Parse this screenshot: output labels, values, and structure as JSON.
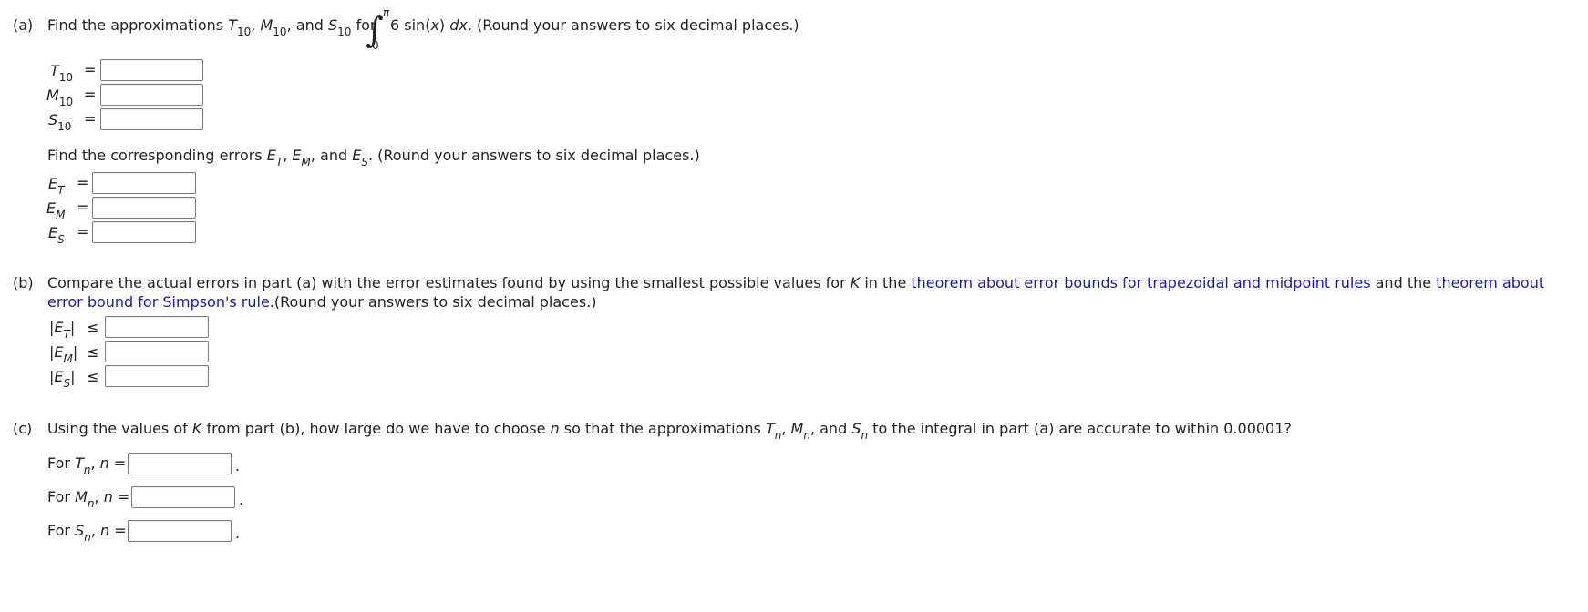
{
  "part_a": {
    "label": "(a)",
    "intro_prefix": "Find the approximations",
    "T": "T",
    "M": "M",
    "S": "S",
    "n10": "10",
    "comma": ",",
    "and": "and",
    "for": "for",
    "integral_sign": "∫",
    "upper_limit": "π",
    "lower_limit": "0",
    "integrand_coef": "6 sin(",
    "integrand_var": "x",
    "integrand_close": ") ",
    "dx_d": "d",
    "dx_x": "x",
    "intro_suffix": ". (Round your answers to six decimal places.)",
    "equals": "=",
    "inputs": {
      "T10": "",
      "M10": "",
      "S10": ""
    },
    "errors_prefix": "Find the corresponding errors",
    "E": "E",
    "subT": "T",
    "subM": "M",
    "subS": "S",
    "errors_suffix": ". (Round your answers to six decimal places.)",
    "error_inputs": {
      "ET": "",
      "EM": "",
      "ES": ""
    }
  },
  "part_b": {
    "label": "(b)",
    "text1": "Compare the actual errors in part (a) with the error estimates found by using the smallest possible values for",
    "K": "K",
    "text2": "in the",
    "link1": "theorem about error bounds for trapezoidal and midpoint rules",
    "text3": "and the",
    "link2": "theorem about",
    "link2b": "error bound for Simpson's rule",
    "text4": ".(Round your answers to six decimal places.)",
    "bar": "|",
    "leq": "≤",
    "inputs": {
      "ET": "",
      "EM": "",
      "ES": ""
    }
  },
  "part_c": {
    "label": "(c)",
    "text1": "Using the values of",
    "K": "K",
    "text2": "from part (b), how large do we have to choose",
    "n": "n",
    "text3": "so that the approximations",
    "text4": "to the integral in part (a) are accurate to within 0.00001?",
    "for": "For",
    "n_eq": "n =",
    "period": ".",
    "inputs": {
      "Tn": "",
      "Mn": "",
      "Sn": ""
    }
  }
}
